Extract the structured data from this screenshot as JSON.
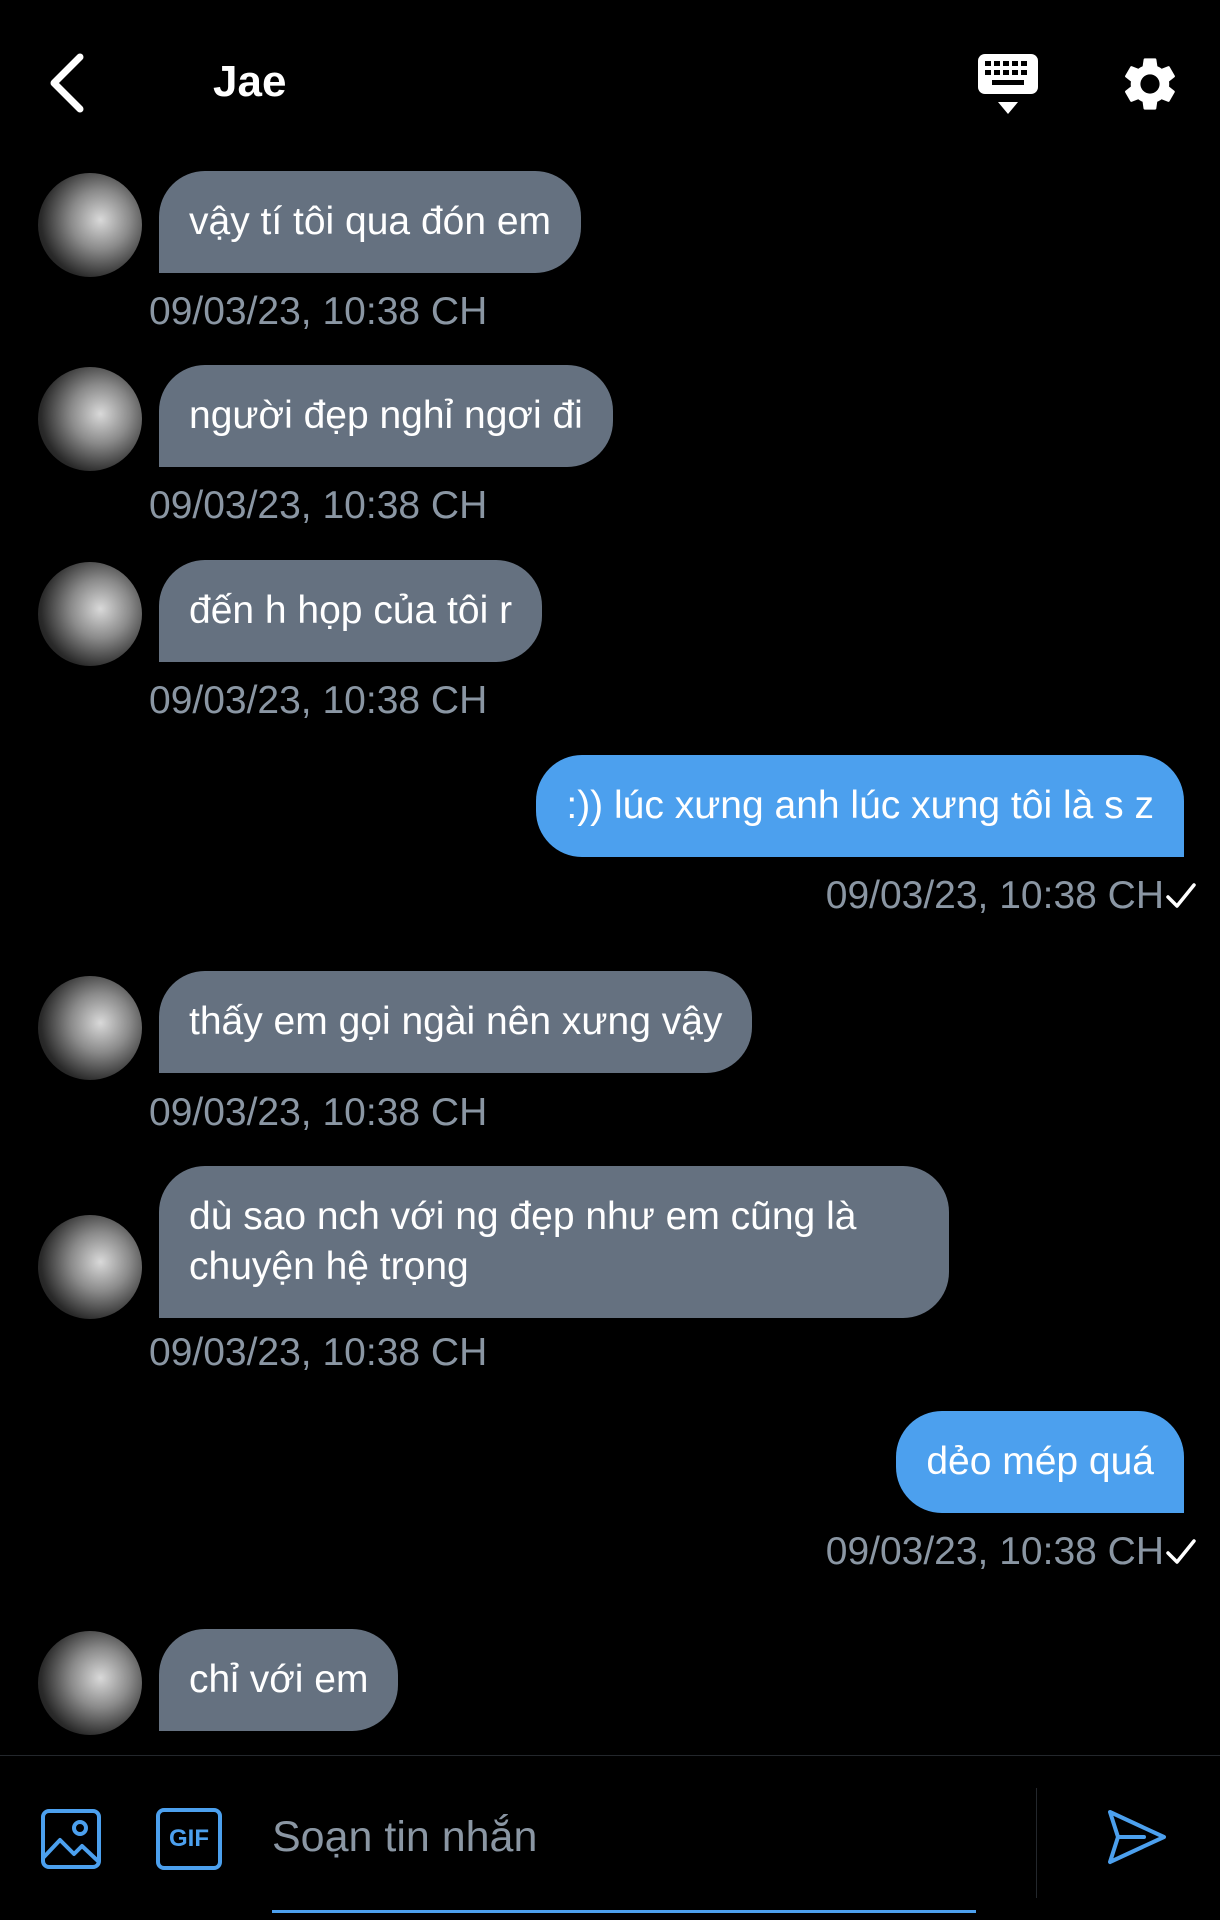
{
  "header": {
    "title": "Jae"
  },
  "messages": [
    {
      "direction": "in",
      "text": "vậy tí tôi qua đón em",
      "time": "09/03/23, 10:38 CH"
    },
    {
      "direction": "in",
      "text": "người đẹp nghỉ ngơi đi",
      "time": "09/03/23, 10:38 CH"
    },
    {
      "direction": "in",
      "text": "đến h họp của tôi r",
      "time": "09/03/23, 10:38 CH"
    },
    {
      "direction": "out",
      "text": ":)) lúc xưng anh lúc xưng tôi là s z",
      "time": "09/03/23, 10:38 CH",
      "read": true
    },
    {
      "direction": "in",
      "text": "thấy em gọi ngài nên xưng vậy",
      "time": "09/03/23, 10:38 CH"
    },
    {
      "direction": "in",
      "text": "dù sao nch với ng đẹp như em cũng là chuyện hệ trọng",
      "time": "09/03/23, 10:38 CH"
    },
    {
      "direction": "out",
      "text": "dẻo mép quá",
      "time": "09/03/23, 10:38 CH",
      "read": true
    },
    {
      "direction": "in",
      "text": "chỉ với em",
      "time": ""
    }
  ],
  "composer": {
    "gif_label": "GIF",
    "placeholder": "Soạn tin nhắn"
  },
  "colors": {
    "background": "#000000",
    "incoming_bubble": "#657180",
    "outgoing_bubble": "#4ca0ee",
    "timestamp": "#8a96a3",
    "accent": "#4ca0ee"
  },
  "icons": [
    "back-arrow-icon",
    "keyboard-icon",
    "gear-icon",
    "image-icon",
    "gif-icon",
    "send-icon",
    "check-icon"
  ]
}
